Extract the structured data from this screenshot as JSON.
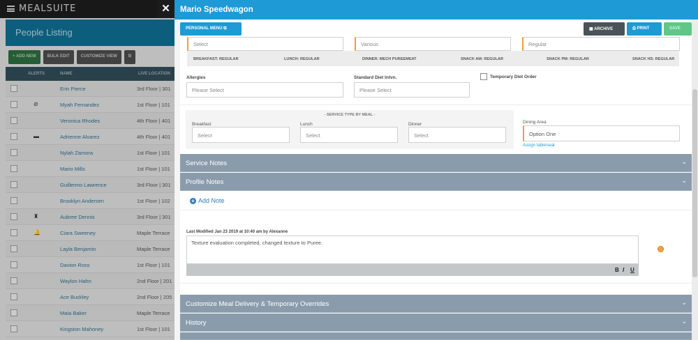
{
  "app": {
    "brand": "MEALSUITE"
  },
  "listing": {
    "title": "People Listing",
    "actions": [
      "+ ADD NEW",
      "BULK EDIT",
      "CUSTOMIZE VIEW",
      "B"
    ],
    "columns": [
      "ALERTS",
      "NAME",
      "LIVE LOCATION"
    ],
    "rows": [
      {
        "alert": "",
        "name": "Erin Pierce",
        "location": "3rd Floor | 301"
      },
      {
        "alert": "no-eating-icon",
        "name": "Myah Fernandez",
        "location": "1st Floor | 101"
      },
      {
        "alert": "",
        "name": "Veronica Rhodes",
        "location": "4th Floor | 401"
      },
      {
        "alert": "bed-icon",
        "name": "Adrienne Alvarez",
        "location": "4th Floor | 401"
      },
      {
        "alert": "",
        "name": "Nylah Zamora",
        "location": "1st Floor | 101"
      },
      {
        "alert": "",
        "name": "Mario Mills",
        "location": "1st Floor | 101"
      },
      {
        "alert": "",
        "name": "Guillermo Lawrence",
        "location": "3rd Floor | 301"
      },
      {
        "alert": "",
        "name": "Brooklyn Andersen",
        "location": "1st Floor | 102"
      },
      {
        "alert": "cake-icon",
        "name": "Aubree Dennis",
        "location": "3rd Floor | 301"
      },
      {
        "alert": "bell-icon",
        "name": "Ciara Sweeney",
        "location": "Maple Terrace"
      },
      {
        "alert": "",
        "name": "Layla Benjamin",
        "location": "Maple Terrace"
      },
      {
        "alert": "",
        "name": "Davion Ross",
        "location": "1st Floor | 101"
      },
      {
        "alert": "",
        "name": "Waylon Hahn",
        "location": "2nd Floor | 201"
      },
      {
        "alert": "",
        "name": "Ace Buckley",
        "location": "2nd Floor | 205"
      },
      {
        "alert": "",
        "name": "Maia Baker",
        "location": "Maple Terrace"
      },
      {
        "alert": "",
        "name": "Kingston Mahoney",
        "location": "1st Floor | 101"
      }
    ]
  },
  "panel": {
    "title": "Mario Speedwagon",
    "personal_menu": "PERSONAL MENU",
    "archive": "ARCHIVE",
    "print": "PRINT",
    "save": "SAVE",
    "top_selects": [
      "Select",
      "Various",
      "Regular"
    ],
    "meal_summary": [
      "BREAKFAST: REGULAR",
      "LUNCH: REGULAR",
      "DINNER: MECH PUREEMEAT",
      "SNACK AM: REGULAR",
      "SNACK PM: REGULAR",
      "SNACK HS: REGULAR"
    ],
    "allergies_label": "Allergies",
    "allergies_placeholder": "Please Select",
    "std_diet_label": "Standard Diet Intvn.",
    "std_diet_placeholder": "Please Select",
    "temp_diet_label": "Temporary Diet Order",
    "service_type_label": "- SERVICE TYPE BY MEAL -",
    "breakfast_label": "Breakfast",
    "lunch_label": "Lunch",
    "dinner_label": "Dinner",
    "meal_placeholder": "Select",
    "dining_label": "Dining Area",
    "dining_value": "Option One",
    "assign_link": "Assign table/seat",
    "service_notes": "Service Notes",
    "profile_notes": "Profile Notes",
    "add_note": "Add Note",
    "last_modified": "Last Modified Jan 23 2019 at 10:40 am by Alexanne",
    "note_text": "Texture evaluation completed, changed texture to Puree.",
    "editor_bold": "B",
    "editor_italic": "I",
    "editor_underline": "U",
    "customize_section": "Customize Meal Delivery & Temporary Overrides",
    "history_section": "History"
  }
}
